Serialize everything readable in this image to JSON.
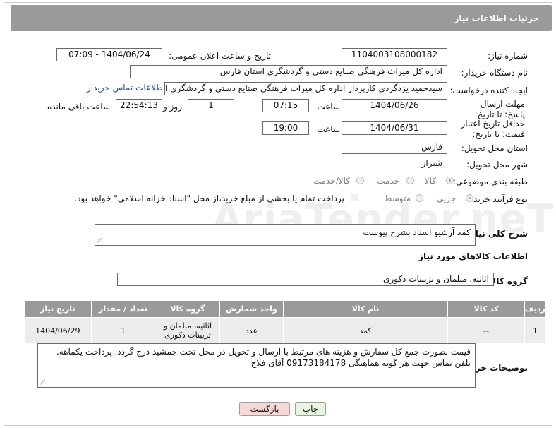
{
  "header": {
    "title": "جزئیات اطلاعات نیاز"
  },
  "fields": {
    "need_number_label": "شماره نیاز:",
    "need_number": "1104003108000182",
    "announce_label": "تاریخ و ساعت اعلان عمومی:",
    "announce_value": "1404/06/24 - 07:09",
    "buyer_org_label": "نام دستگاه خریدار:",
    "buyer_org": "اداره کل میراث فرهنگی  صنایع دستی و گردشگری استان فارس",
    "creator_label": "ایجاد کننده درخواست:",
    "creator": "سیدحمید یزدگردی کارپرداز اداره کل میراث فرهنگی  صنایع دستی و گردشگری استان فارس",
    "buyer_contact_link": "اطلاعات تماس خریدار",
    "reply_deadline_label": "مهلت ارسال پاسخ: تا تاریخ:",
    "reply_date": "1404/06/26",
    "time_label": "ساعت",
    "reply_time": "07:15",
    "days_value": "1",
    "days_label": "روز و",
    "remaining_time": "22:54:13",
    "remaining_label": "ساعت باقی مانده",
    "price_validity_label": "حداقل تاریخ اعتبار قیمت: تا تاریخ:",
    "price_date": "1404/06/31",
    "price_time": "19:00",
    "province_label": "استان محل تحویل:",
    "province": "فارس",
    "city_label": "شهر محل تحویل:",
    "city": "شیراز",
    "category_label": "طبقه بندی موضوعی:",
    "category_options": [
      "کالا",
      "خدمت",
      "کالا/خدمت"
    ],
    "category_selected": "کالا",
    "process_label": "نوع فرآیند خرید :",
    "process_options": [
      "جزیی",
      "متوسط"
    ],
    "process_selected": "جزیی",
    "payment_note": "پرداخت تمام یا بخشی از مبلغ خرید،از محل \"اسناد خزانه اسلامی\" خواهد بود."
  },
  "description": {
    "label": "شرح کلی نیاز:",
    "value": "کمد آرشیو اسناد بشرح پیوست"
  },
  "goods_info": {
    "title": "اطلاعات کالاهای مورد نیاز",
    "group_label": "گروه کالا:",
    "group_value": "اثاثیه، مبلمان و تزیینات دکوری"
  },
  "table": {
    "headers": [
      "ردیف",
      "کد کالا",
      "نام کالا",
      "واحد شمارش",
      "گروه کالا",
      "تعداد / مقدار",
      "تاریخ نیاز"
    ],
    "rows": [
      [
        "1",
        "--",
        "کمد",
        "عدد",
        "اثاثیه، مبلمان و تزیینات دکوری",
        "1",
        "1404/06/29"
      ]
    ]
  },
  "buyer_notes": {
    "label": "توضیحات خریدار:",
    "value": "قیمت بصورت جمع کل سفارش و هزینه های مرتبط با ارسال و تحویل در محل تخت جمشید درج گردد. پرداخت یکماهه. تلفن تماس جهت هر گونه هماهنگی 09173184178 آقای فلاح"
  },
  "buttons": {
    "print": "چاپ",
    "back": "بازگشت"
  },
  "watermark": "AriaTender.neT",
  "colors": {
    "header": "#9a9a9a",
    "link": "#1a4fa0",
    "back_button": "#f8d7d7",
    "print_button": "#eaf5e0"
  }
}
